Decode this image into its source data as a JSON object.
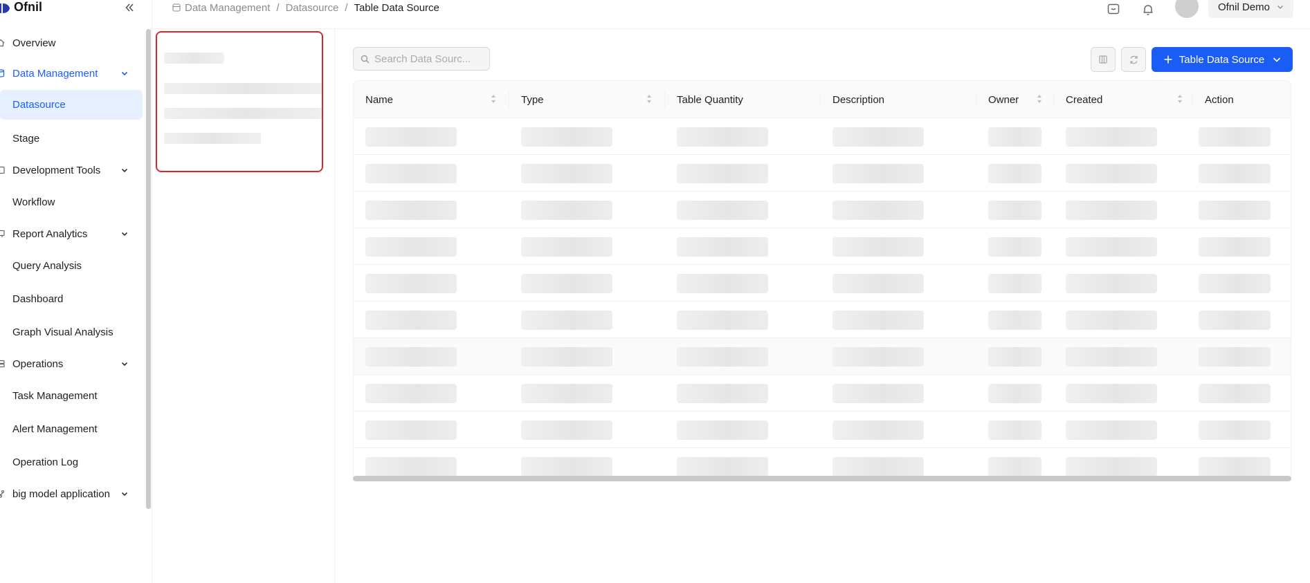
{
  "app": {
    "brand_name": "Ofnil"
  },
  "sidebar": {
    "items": [
      {
        "label": "Overview",
        "type": "item"
      },
      {
        "label": "Data Management",
        "type": "group",
        "open": true
      },
      {
        "label": "Datasource",
        "type": "sub",
        "active": true
      },
      {
        "label": "Stage",
        "type": "sub"
      },
      {
        "label": "Development Tools",
        "type": "group"
      },
      {
        "label": "Workflow",
        "type": "sub"
      },
      {
        "label": "Report Analytics",
        "type": "group"
      },
      {
        "label": "Query Analysis",
        "type": "sub"
      },
      {
        "label": "Dashboard",
        "type": "sub"
      },
      {
        "label": "Graph Visual Analysis",
        "type": "sub"
      },
      {
        "label": "Operations",
        "type": "group"
      },
      {
        "label": "Task Management",
        "type": "sub"
      },
      {
        "label": "Alert Management",
        "type": "sub"
      },
      {
        "label": "Operation Log",
        "type": "sub"
      },
      {
        "label": "big model application",
        "type": "group"
      }
    ]
  },
  "breadcrumb": {
    "items": [
      "Data Management",
      "Datasource",
      "Table Data Source"
    ],
    "separator": "/"
  },
  "header": {
    "user_name": "Ofnil Demo",
    "icons": [
      "chat-icon",
      "bell-icon"
    ]
  },
  "toolbar": {
    "search_placeholder": "Search Data Sourc...",
    "add_button_label": "Table Data Source"
  },
  "table": {
    "columns": [
      "Name",
      "Type",
      "Table Quantity",
      "Description",
      "Owner",
      "Created",
      "Action"
    ],
    "loading_rows": 10
  },
  "colors": {
    "accent": "#1b5cf5",
    "active_bg": "#e6f0ff",
    "highlight_border": "#e0242c"
  }
}
